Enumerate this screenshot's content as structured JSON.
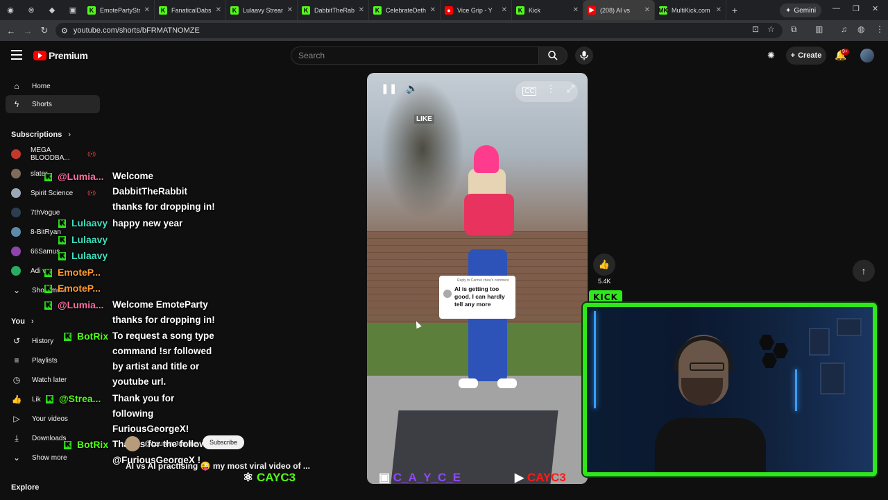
{
  "browser": {
    "tabs": [
      {
        "title": "EmotePartyStr",
        "color": "#53fc18",
        "icon": "K"
      },
      {
        "title": "FanaticalDabsS",
        "color": "#53fc18",
        "icon": "K"
      },
      {
        "title": "Lulaavy Stream",
        "color": "#53fc18",
        "icon": "K"
      },
      {
        "title": "DabbitTheRabb",
        "color": "#53fc18",
        "icon": "K"
      },
      {
        "title": "CelebrateDeth",
        "color": "#53fc18",
        "icon": "K"
      },
      {
        "title": "Vice Grip - Y",
        "color": "#ff0000",
        "icon": "●"
      },
      {
        "title": "Kick",
        "color": "#53fc18",
        "icon": "K"
      },
      {
        "title": "(208) AI vs",
        "color": "#ff0000",
        "icon": "▶"
      },
      {
        "title": "MultiKick.com",
        "color": "#53fc18",
        "icon": "MK"
      }
    ],
    "gemini_label": "Gemini",
    "url": "youtube.com/shorts/bFRMATNOMZE"
  },
  "yt": {
    "brand": "Premium",
    "search_placeholder": "Search",
    "create_label": "Create",
    "notif_badge": "9+"
  },
  "sidebar": {
    "home": "Home",
    "shorts": "Shorts",
    "subscriptions_label": "Subscriptions",
    "subs": [
      {
        "name": "MEGA BLOODBA...",
        "color": "#c0392b"
      },
      {
        "name": "slater",
        "color": "#7f6a5b"
      },
      {
        "name": "Spirit Science",
        "color": "#9aa7b4"
      },
      {
        "name": "7thVogue",
        "color": "#2c3e50"
      },
      {
        "name": "8-BitRyan",
        "color": "#5d8aa8"
      },
      {
        "name": "66Samus",
        "color": "#8e44ad"
      },
      {
        "name": "Adi ve",
        "color": "#27ae60"
      },
      {
        "name": "Show more",
        "color": ""
      }
    ],
    "you_label": "You",
    "you_items": [
      "History",
      "Playlists",
      "Watch later",
      "Lik",
      "Your videos",
      "Downloads",
      "Show more"
    ],
    "explore_label": "Explore"
  },
  "short": {
    "like_caption": "LIKE",
    "reply_to": "Reply to Carmel chew's comment",
    "comment": "AI is getting too good. I can hardly tell any more",
    "like_count": "5.4K",
    "uploader": "@Lauren.Jumme",
    "subscribe_label": "Subscribe",
    "title": "AI vs AI practising 😜 my most viral video of ..."
  },
  "overlay": {
    "kick_tag": "KICK",
    "chat_names": [
      {
        "name": "@Lumia...",
        "cls": "nm-pink"
      },
      {
        "name": "Lulaavy",
        "cls": "nm-teal"
      },
      {
        "name": "Lulaavy",
        "cls": "nm-teal"
      },
      {
        "name": "Lulaavy",
        "cls": "nm-teal"
      },
      {
        "name": "EmoteP...",
        "cls": "nm-orange"
      },
      {
        "name": "EmoteP...",
        "cls": "nm-orange"
      },
      {
        "name": "@Lumia...",
        "cls": "nm-pink"
      },
      {
        "name": "BotRix",
        "cls": "nm-green"
      },
      {
        "name": "@Strea...",
        "cls": "nm-green"
      },
      {
        "name": "BotRix",
        "cls": "nm-green"
      }
    ],
    "messages": [
      "Welcome",
      "DabbitTheRabbit",
      "thanks for dropping in!",
      "happy new year",
      "Welcome EmoteParty",
      "thanks for dropping in!",
      "To request a song type",
      "command !sr followed",
      "by artist and title or",
      "youtube url.",
      "Thank you for",
      "following",
      "FuriousGeorgeX!",
      "Thanks for the follow",
      "@FuriousGeorgeX !"
    ],
    "brand_kick": "CAYC3",
    "brand_twitch": "C_A_Y_C_E",
    "brand_yt": "CAYC3"
  }
}
